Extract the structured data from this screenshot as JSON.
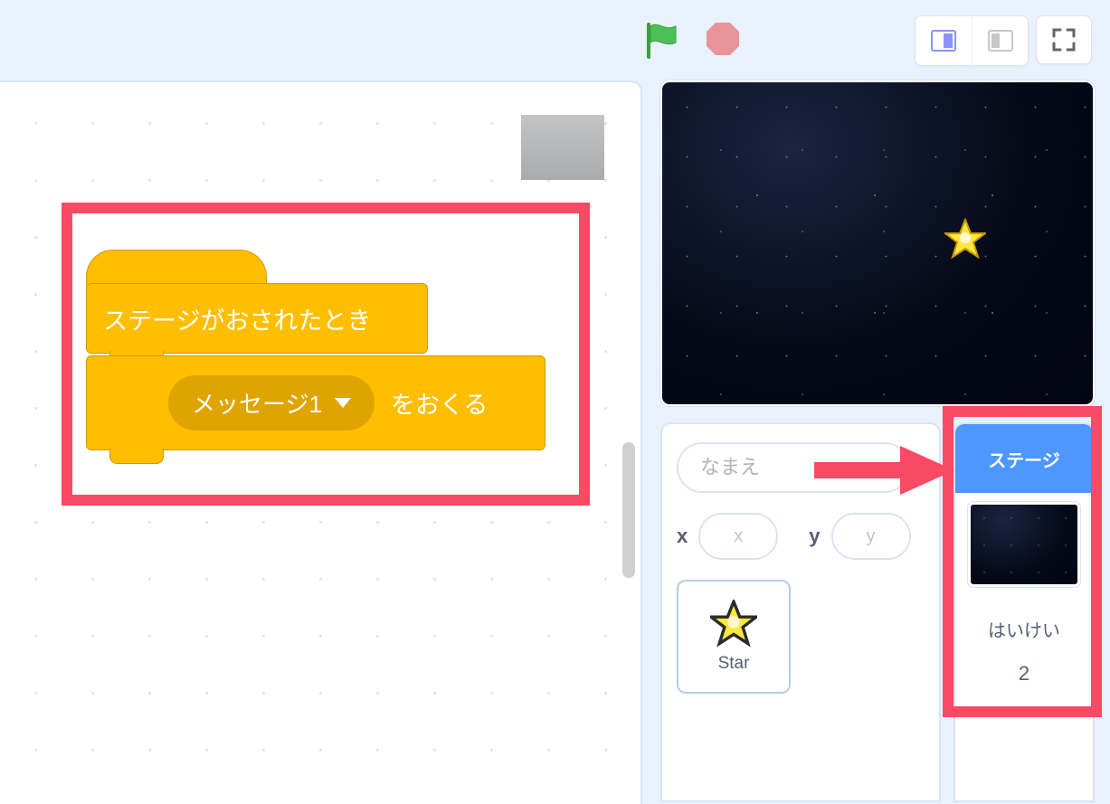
{
  "blocks": {
    "hat_label": "ステージがおされたとき",
    "broadcast_dropdown": "メッセージ1",
    "broadcast_suffix": "をおくる"
  },
  "sprite_panel": {
    "name_placeholder": "なまえ",
    "x_label": "x",
    "x_placeholder": "x",
    "y_label": "y",
    "y_placeholder": "y",
    "sprite_tile_label": "Star"
  },
  "stage_panel": {
    "header": "ステージ",
    "backdrop_label": "はいけい",
    "backdrop_count": "2"
  },
  "colors": {
    "highlight": "#f84a63",
    "accent": "#4d97ff",
    "block": "#ffbe00"
  }
}
